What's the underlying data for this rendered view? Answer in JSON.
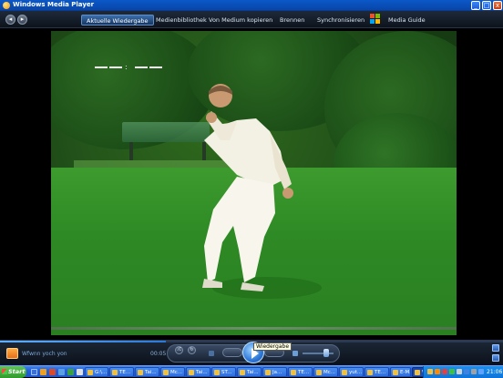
{
  "window": {
    "title": "Windows Media Player",
    "minimize": "_",
    "maximize": "□",
    "close": "x"
  },
  "nav": {
    "back": "◂",
    "forward": "▸",
    "tabs": [
      {
        "label": "Aktuelle Wiedergabe",
        "active": true
      },
      {
        "label": "Medienbibliothek",
        "active": false
      },
      {
        "label": "Von Medium kopieren",
        "active": false
      },
      {
        "label": "Brennen",
        "active": false
      },
      {
        "label": "Synchronisieren",
        "active": false
      },
      {
        "label": "Media Guide",
        "active": false
      }
    ]
  },
  "video": {
    "caption": "-- : --"
  },
  "controls": {
    "now_playing": "Wfwnn yoch yon",
    "time": "00:05",
    "tooltip": "Wiedergabe",
    "progress": 0.33,
    "volume": 0.75,
    "shuffle": "⤮",
    "repeat": "↻"
  },
  "taskbar": {
    "start_label": "Start",
    "items": [
      {
        "label": "G:\\..."
      },
      {
        "label": "TE..."
      },
      {
        "label": "Tai..."
      },
      {
        "label": "Mc..."
      },
      {
        "label": "Tai..."
      },
      {
        "label": "ST..."
      },
      {
        "label": "Tai..."
      },
      {
        "label": "Ja..."
      },
      {
        "label": "TE..."
      },
      {
        "label": "Mc..."
      },
      {
        "label": "yut..."
      },
      {
        "label": "TE..."
      },
      {
        "label": "E-M..."
      },
      {
        "label": "Win..."
      }
    ],
    "clock": "21:06"
  },
  "colors": {
    "accent": "#2e78d8",
    "nav_bg": "#0d131c",
    "taskbar": "#245edb",
    "start_green": "#2f9a2b"
  }
}
